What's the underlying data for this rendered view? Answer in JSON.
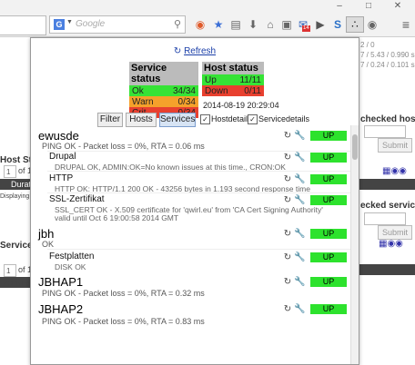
{
  "toolbar": {
    "search_engine": "G",
    "search_placeholder": "Google",
    "icons": [
      "reddit-icon",
      "bookmark-star-icon",
      "clipboard-icon",
      "download-icon",
      "home-icon",
      "screenshot-icon",
      "mail-icon",
      "video-icon",
      "security-icon",
      "shield-icon",
      "extension-icon",
      "chat-icon",
      "menu-icon"
    ],
    "badge_count": "14"
  },
  "background": {
    "left_texts": [
      "Host Stat",
      "of 1",
      "Displaying R",
      "Service Sta",
      "of 1",
      "Displaying Re"
    ],
    "left_values": [
      "1",
      "1"
    ],
    "column_header": "Durati",
    "right_texts": [
      "2 / 0",
      "7 / 5.43 / 0.990 s",
      "7 / 0.24 / 0.101 s",
      "checked host(s)",
      "ecked services"
    ],
    "submit_label": "Submit"
  },
  "popup": {
    "refresh_label": "Refresh",
    "service_status": {
      "header": "Service status",
      "rows": [
        {
          "label": "Ok",
          "value": "34/34",
          "color": "#36e336"
        },
        {
          "label": "Warn",
          "value": "0/34",
          "color": "#f5a12b"
        },
        {
          "label": "Crit",
          "value": "0/34",
          "color": "#e8402f"
        }
      ]
    },
    "host_status": {
      "header": "Host status",
      "rows": [
        {
          "label": "Up",
          "value": "11/11",
          "color": "#36e336"
        },
        {
          "label": "Down",
          "value": "0/11",
          "color": "#e8402f"
        }
      ]
    },
    "timestamp": "2014-08-19 20:29:04",
    "tabs": [
      "Filter",
      "Hosts",
      "Services"
    ],
    "active_tab": "Services",
    "checkboxes": [
      {
        "label": "Hostdetails",
        "checked": true
      },
      {
        "label": "Servicedetails",
        "checked": true
      }
    ],
    "hosts": [
      {
        "name": "ewusde",
        "message": "PING OK - Packet loss = 0%, RTA = 0.06 ms",
        "status": "UP",
        "services": [
          {
            "name": "Drupal",
            "message": "DRUPAL OK, ADMIN:OK=No known issues at this time., CRON:OK",
            "status": "OK"
          },
          {
            "name": "HTTP",
            "message": "HTTP OK: HTTP/1.1 200 OK - 43256 bytes in 1.193 second response time",
            "status": "OK"
          },
          {
            "name": "SSL-Zertifikat",
            "message": "SSL_CERT OK - X.509 certificate for 'qwirl.eu' from 'CA Cert Signing Authority'",
            "message2": "valid until Oct 6 19:00:58 2014 GMT",
            "status": "OK"
          }
        ]
      },
      {
        "name": "jbh",
        "message": "OK",
        "status": "UP",
        "services": [
          {
            "name": "Festplatten",
            "message": "DISK OK",
            "status": "OK"
          }
        ]
      },
      {
        "name": "JBHAP1",
        "message": "PING OK - Packet loss = 0%, RTA = 0.32 ms",
        "status": "UP",
        "services": []
      },
      {
        "name": "JBHAP2",
        "message": "PING OK - Packet loss = 0%, RTA = 0.83 ms",
        "status": "UP",
        "services": []
      }
    ]
  }
}
